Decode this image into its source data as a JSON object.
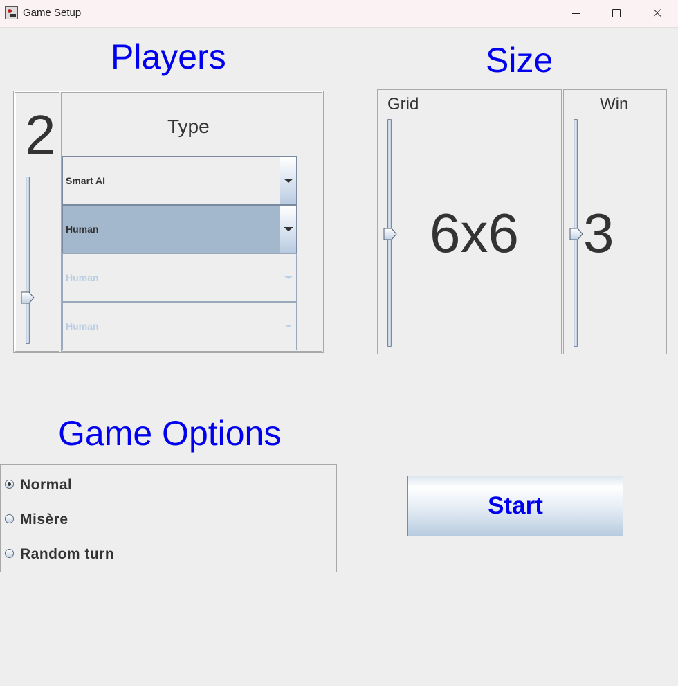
{
  "window": {
    "title": "Game Setup",
    "controls": {
      "minimize_icon": "minimize-icon",
      "maximize_icon": "maximize-icon",
      "close_icon": "close-icon"
    }
  },
  "players": {
    "heading": "Players",
    "count": "2",
    "count_slider_fraction": 0.25,
    "type_label": "Type",
    "types": [
      {
        "label": "Smart AI",
        "state": "enabled"
      },
      {
        "label": "Human",
        "state": "selected"
      },
      {
        "label": "Human",
        "state": "disabled"
      },
      {
        "label": "Human",
        "state": "disabled"
      }
    ]
  },
  "size": {
    "heading": "Size",
    "grid_label": "Grid",
    "grid_value": "6x6",
    "grid_slider_fraction": 0.5,
    "win_label": "Win",
    "win_value": "3",
    "win_slider_fraction": 0.5
  },
  "options": {
    "heading": "Game Options",
    "choices": [
      {
        "label": "Normal",
        "selected": true
      },
      {
        "label": "Misère",
        "selected": false
      },
      {
        "label": "Random turn",
        "selected": false
      }
    ]
  },
  "start_label": "Start",
  "colors": {
    "heading": "#0000ee",
    "accent_blue": "#b9cbe0",
    "selected_row": "#a3b8cc"
  }
}
